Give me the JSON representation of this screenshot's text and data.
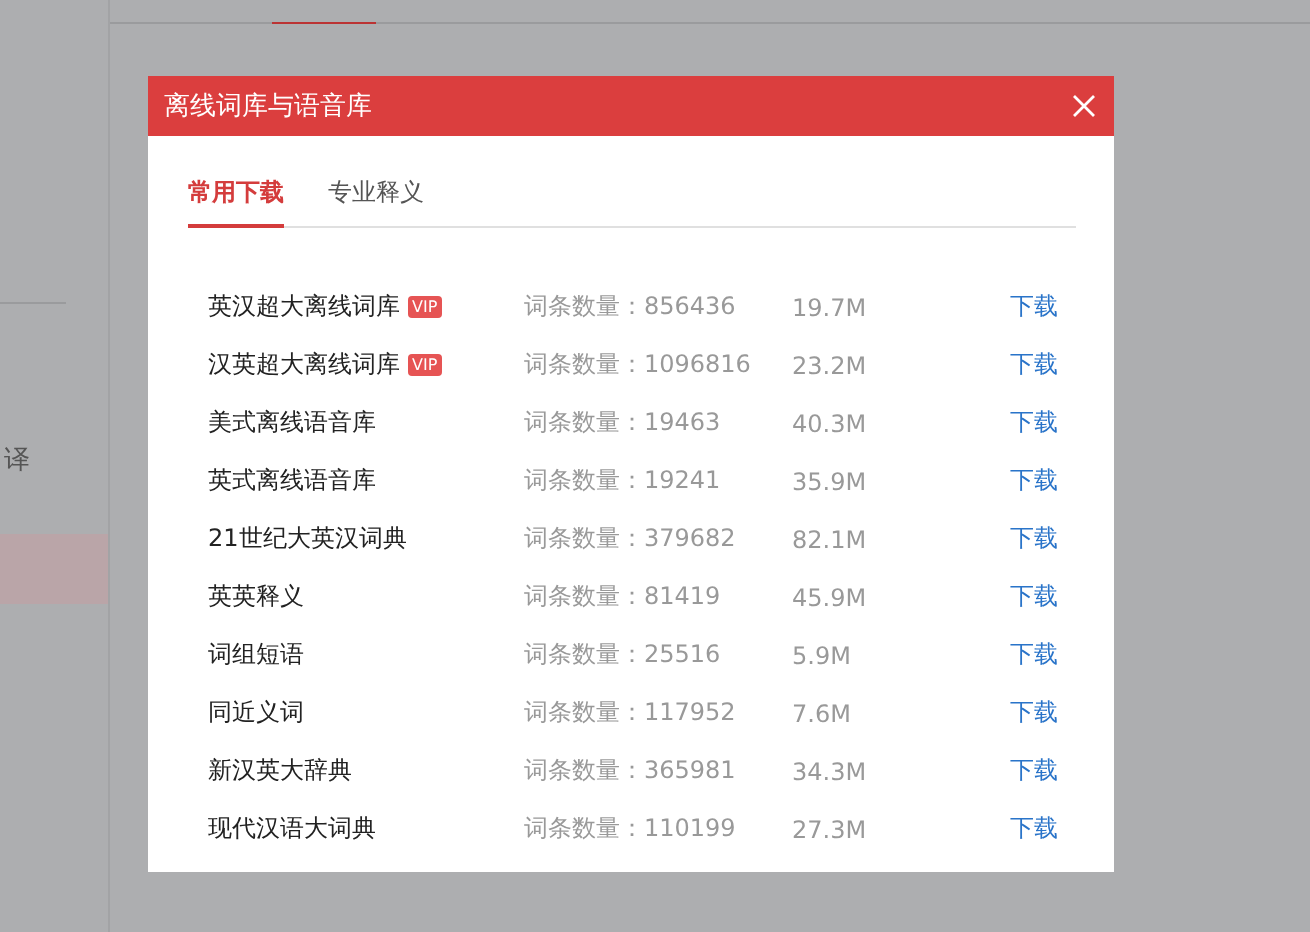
{
  "background": {
    "sidebar": {
      "items": [
        {
          "label": "译",
          "selected": false
        },
        {
          "selected": true
        }
      ]
    }
  },
  "dialog": {
    "title": "离线词库与语音库",
    "tabs": [
      {
        "label": "常用下载",
        "selected": true
      },
      {
        "label": "专业释义",
        "selected": false
      }
    ],
    "rows": [
      {
        "name": "英汉超大离线词库",
        "badge": "VIP",
        "count": "词条数量：856436",
        "size": "19.7M",
        "action": "下载"
      },
      {
        "name": "汉英超大离线词库",
        "badge": "VIP",
        "count": "词条数量：1096816",
        "size": "23.2M",
        "action": "下载"
      },
      {
        "name": "美式离线语音库",
        "count": "词条数量：19463",
        "size": "40.3M",
        "action": "下载"
      },
      {
        "name": "英式离线语音库",
        "count": "词条数量：19241",
        "size": "35.9M",
        "action": "下载"
      },
      {
        "name": "21世纪大英汉词典",
        "count": "词条数量：379682",
        "size": "82.1M",
        "action": "下载"
      },
      {
        "name": "英英释义",
        "count": "词条数量：81419",
        "size": "45.9M",
        "action": "下载"
      },
      {
        "name": "词组短语",
        "count": "词条数量：25516",
        "size": "5.9M",
        "action": "下载"
      },
      {
        "name": "同近义词",
        "count": "词条数量：117952",
        "size": "7.6M",
        "action": "下载"
      },
      {
        "name": "新汉英大辞典",
        "count": "词条数量：365981",
        "size": "34.3M",
        "action": "下载"
      },
      {
        "name": "现代汉语大词典",
        "count": "词条数量：110199",
        "size": "27.3M",
        "action": "下载"
      }
    ]
  }
}
